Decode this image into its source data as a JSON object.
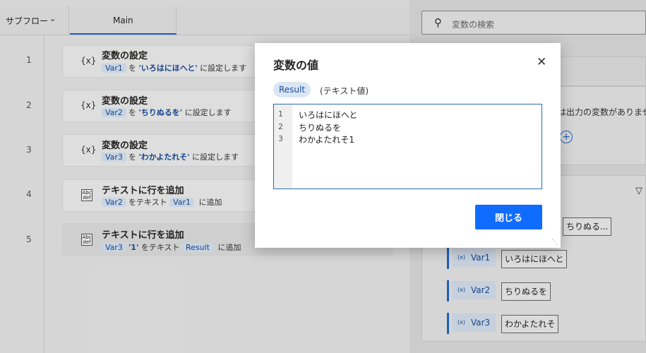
{
  "header": {
    "subflow_label": "サブフロー",
    "main_tab_label": "Main"
  },
  "steps": [
    {
      "num": "1",
      "title": "変数の設定",
      "var": "Var1",
      "to": "を",
      "literal": "'いろはにほへと'",
      "suffix": "に設定します"
    },
    {
      "num": "2",
      "title": "変数の設定",
      "var": "Var2",
      "to": "を",
      "literal": "'ちりぬるを'",
      "suffix": "に設定します"
    },
    {
      "num": "3",
      "title": "変数の設定",
      "var": "Var3",
      "to": "を",
      "literal": "'わかよたれそ'",
      "suffix": "に設定します"
    },
    {
      "num": "4",
      "title": "テキストに行を追加",
      "var": "Var2",
      "mid": "をテキスト",
      "var2": "Var1",
      "suffix": "に追加"
    },
    {
      "num": "5",
      "title": "テキストに行を追加",
      "var": "Var3",
      "literal": "'1'",
      "mid": "をテキスト",
      "var2": "Result",
      "suffix": "に追加"
    }
  ],
  "right_panel": {
    "search_placeholder": "変数の検索",
    "no_output_text": "は出力の変数がありませ",
    "var_list": [
      {
        "name": "Var1",
        "value": "いろはにほへと"
      },
      {
        "name": "Var2",
        "value": "ちりぬるを"
      },
      {
        "name": "Var3",
        "value": "わかよたれそ"
      }
    ],
    "extra_value": "ちりぬる...",
    "var_prefix": "(x)"
  },
  "dialog": {
    "title": "変数の値",
    "var_name": "Result",
    "var_type": "(テキスト値)",
    "lines": [
      {
        "n": "1",
        "text": "いろはにほへと"
      },
      {
        "n": "2",
        "text": "ちりぬるを"
      },
      {
        "n": "3",
        "text": "わかよたれそ1"
      }
    ],
    "close_button": "閉じる"
  },
  "icons": {
    "chevron": "chevron-down-icon",
    "search": "search-icon",
    "close": "close-icon",
    "filter": "filter-icon",
    "add": "add-circle-icon"
  },
  "colors": {
    "accent": "#0f6cff",
    "chip_bg": "#dbe6f5",
    "chip_text": "#174c9a"
  }
}
